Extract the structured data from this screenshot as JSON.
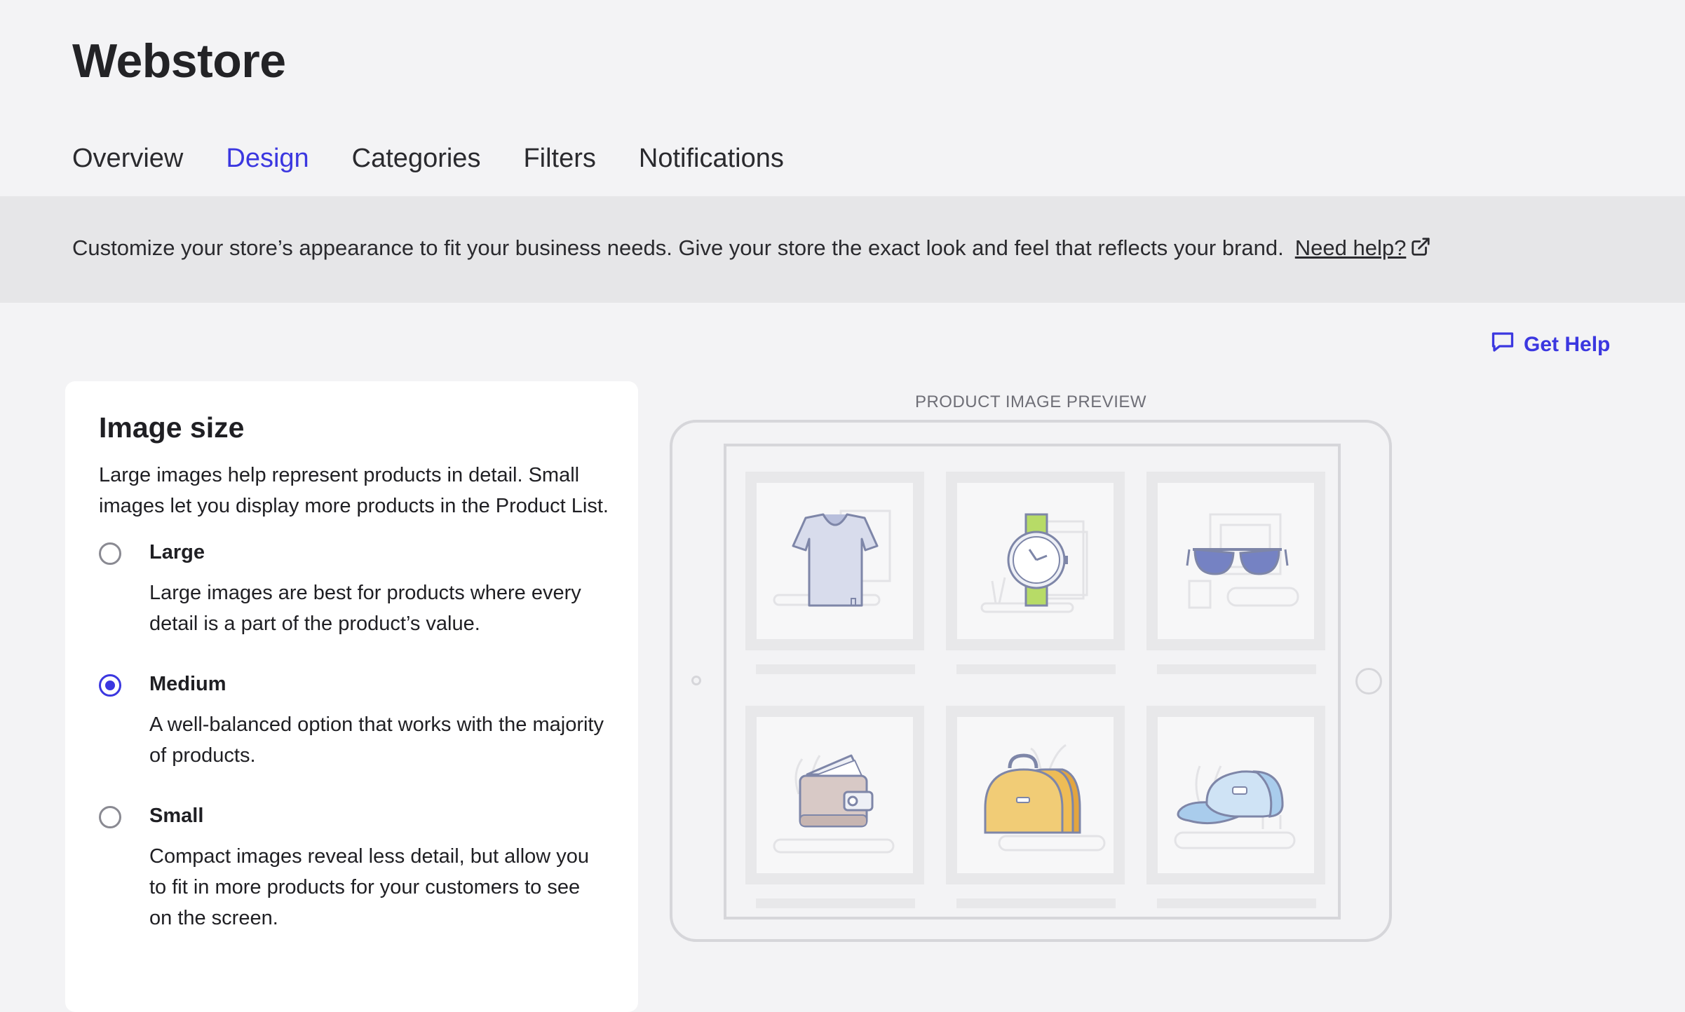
{
  "header": {
    "title": "Webstore"
  },
  "tabs": [
    {
      "label": "Overview"
    },
    {
      "label": "Design",
      "active": true
    },
    {
      "label": "Categories"
    },
    {
      "label": "Filters"
    },
    {
      "label": "Notifications"
    }
  ],
  "banner": {
    "text": "Customize your store’s appearance to fit your business needs. Give your store the exact look and feel that reflects your brand.",
    "link_label": "Need help?"
  },
  "get_help": {
    "label": "Get Help"
  },
  "image_size": {
    "title": "Image size",
    "description": "Large images help represent products in detail. Small images let you display more products in the Product List.",
    "selected": "Medium",
    "options": [
      {
        "label": "Large",
        "description": "Large images are best for products where every detail is a part of the product’s value."
      },
      {
        "label": "Medium",
        "description": "A well-balanced option that works with the majority of products."
      },
      {
        "label": "Small",
        "description": "Compact images reveal less detail, but allow you to fit in more products for your customers to see on the screen."
      }
    ]
  },
  "preview": {
    "label": "PRODUCT IMAGE PREVIEW",
    "products": [
      "t-shirt-icon",
      "watch-icon",
      "sunglasses-icon",
      "wallet-icon",
      "bag-icon",
      "cap-icon"
    ]
  },
  "colors": {
    "accent": "#3b37e0",
    "background": "#f3f3f5",
    "banner": "#e6e6e8"
  }
}
